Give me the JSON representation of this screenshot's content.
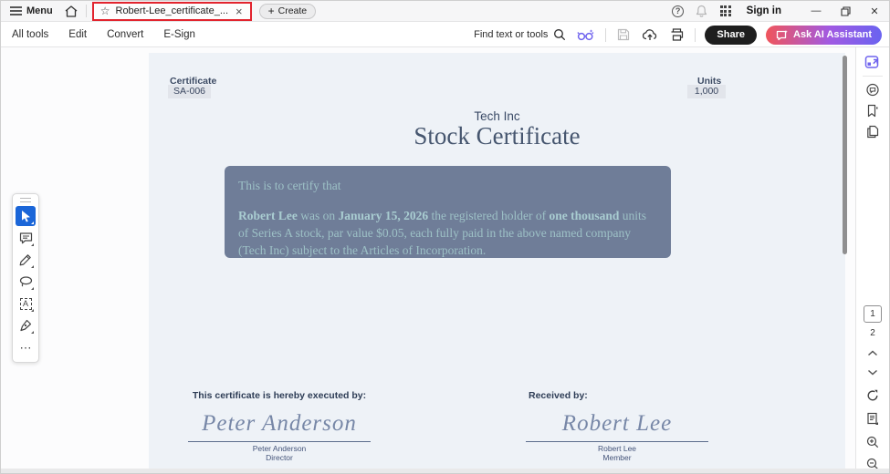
{
  "icons": {
    "star": "☆",
    "close_x": "×",
    "plus": "+",
    "help": "?",
    "minimize": "—",
    "close_window": "✕",
    "more": "⋯",
    "text_tool_letter": "A"
  },
  "titlebar": {
    "menu": "Menu",
    "tab_title": "Robert-Lee_certificate_...",
    "create": "Create",
    "sign_in": "Sign in"
  },
  "toolbar": {
    "all_tools": "All tools",
    "edit": "Edit",
    "convert": "Convert",
    "esign": "E-Sign",
    "find": "Find text or tools",
    "share": "Share",
    "ask_ai": "Ask AI Assistant"
  },
  "doc": {
    "certificate_label": "Certificate",
    "certificate_id": "SA-006",
    "units_label": "Units",
    "units_value": "1,000",
    "company": "Tech Inc",
    "title": "Stock Certificate",
    "intro": "This is to certify that",
    "body": {
      "holder": "Robert Lee",
      "t1": " was on ",
      "date": "January 15, 2026",
      "t2": " the registered holder of ",
      "amount": "one thousand",
      "t3": " units of Series A stock, par value $0.05, each fully paid in the above named company (Tech Inc) subject to the Articles of Incorporation."
    },
    "executed_by": "This certificate is hereby executed by:",
    "received_by": "Received by:",
    "signer1": {
      "signature": "Peter Anderson",
      "name": "Peter Anderson",
      "role": "Director"
    },
    "signer2": {
      "signature": "Robert Lee",
      "name": "Robert Lee",
      "role": "Member"
    }
  },
  "pager": {
    "current": "1",
    "next": "2"
  },
  "colors": {
    "accent_blue": "#1b66d8",
    "tab_highlight_red": "#e2242e",
    "share_black": "#1e1e1e",
    "ai_gradient_start": "#f0555b",
    "ai_gradient_end": "#6a63f0",
    "ai_icon_purple": "#6f63ee",
    "page_bg": "#eef2f7",
    "cert_box_bg": "#6f7d98",
    "cert_box_text": "#9dc1c6",
    "doc_heading": "#46566f",
    "signature_ink": "#7787a7"
  }
}
